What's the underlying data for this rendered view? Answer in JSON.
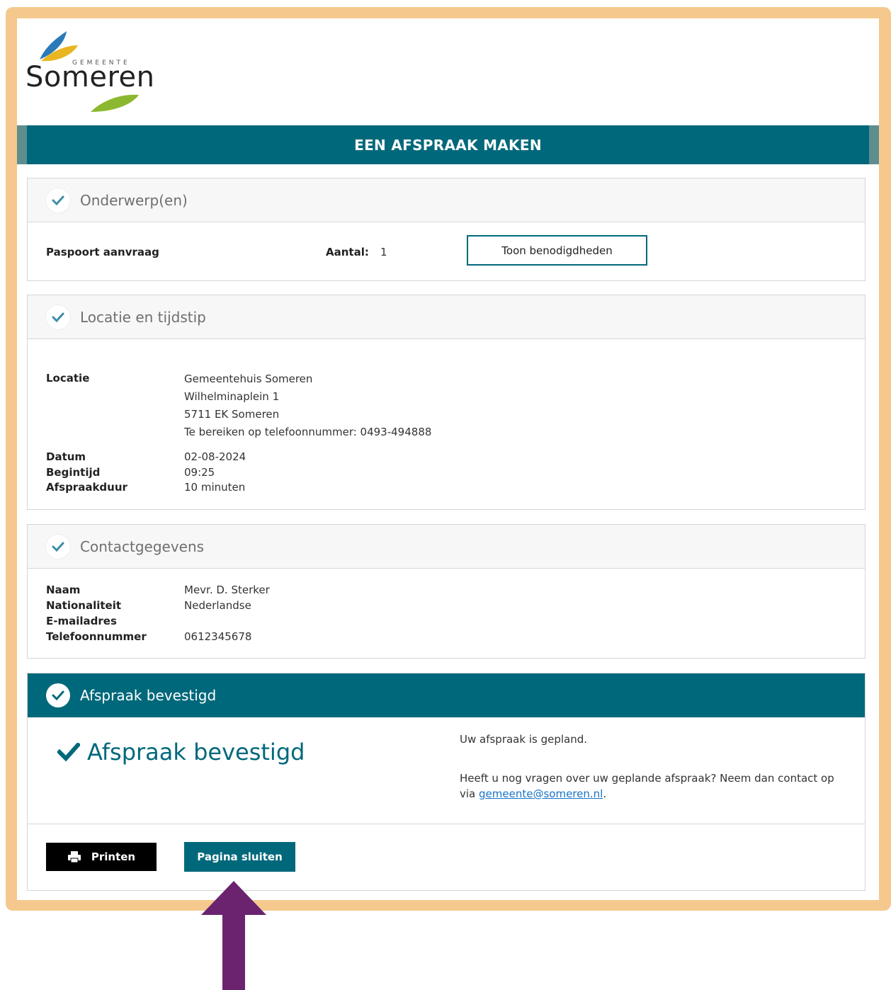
{
  "logo": {
    "gemeente": "GEMEENTE",
    "name": "Someren"
  },
  "header": {
    "title": "EEN AFSPRAAK MAKEN"
  },
  "subjects": {
    "title": "Onderwerp(en)",
    "product": "Paspoort aanvraag",
    "aantal_label": "Aantal:",
    "aantal_value": "1",
    "button_label": "Toon benodigdheden"
  },
  "location": {
    "title": "Locatie en tijdstip",
    "locatie_label": "Locatie",
    "address_lines": [
      "Gemeentehuis Someren",
      "Wilhelminaplein 1",
      "5711 EK Someren",
      "Te bereiken op telefoonnummer: 0493-494888"
    ],
    "datum_label": "Datum",
    "datum_value": "02-08-2024",
    "begintijd_label": "Begintijd",
    "begintijd_value": "09:25",
    "duur_label": "Afspraakduur",
    "duur_value": "10 minuten"
  },
  "contact": {
    "title": "Contactgegevens",
    "naam_label": "Naam",
    "naam_value": "Mevr. D. Sterker",
    "nationaliteit_label": "Nationaliteit",
    "nationaliteit_value": "Nederlandse",
    "email_label": "E-mailadres",
    "telefoon_label": "Telefoonnummer",
    "telefoon_value": "0612345678"
  },
  "confirmation": {
    "title": "Afspraak bevestigd",
    "big_text": "Afspraak bevestigd",
    "planned_text": "Uw afspraak is gepland.",
    "question_text": "Heeft u nog vragen over uw geplande afspraak? Neem dan contact op",
    "via_text": "via",
    "email_link": "gemeente@someren.nl",
    "period": "."
  },
  "actions": {
    "print_label": "Printen",
    "close_label": "Pagina sluiten"
  },
  "colors": {
    "brand_teal": "#00687b",
    "frame_orange": "#f5c98e",
    "arrow_purple": "#6b2370"
  }
}
